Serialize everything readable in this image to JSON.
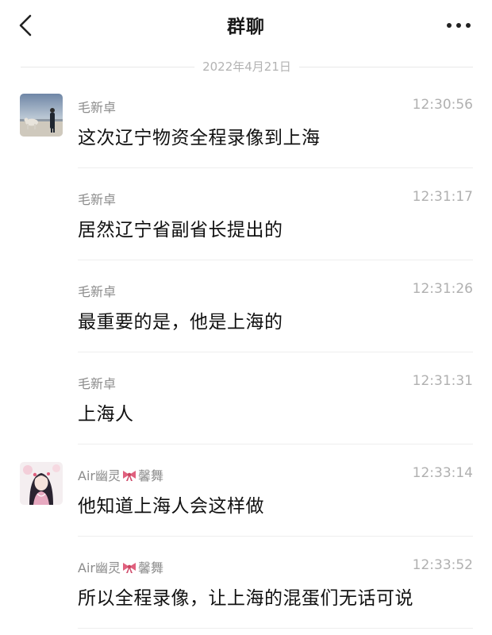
{
  "header": {
    "title": "群聊",
    "back_icon": "chevron-left-icon",
    "more_icon": "more-dots-icon"
  },
  "date_divider": "2022年4月21日",
  "colors": {
    "text_primary": "#111111",
    "text_secondary": "#8c8c8c",
    "time": "#b0b0b0",
    "divider": "#eeeeee",
    "bow_pink": "#e0607e"
  },
  "messages": [
    {
      "sender": "毛新卓",
      "time": "12:30:56",
      "text": "这次辽宁物资全程录像到上海",
      "avatar": "beach-photo-avatar"
    },
    {
      "sender": "毛新卓",
      "time": "12:31:17",
      "text": "居然辽宁省副省长提出的"
    },
    {
      "sender": "毛新卓",
      "time": "12:31:26",
      "text": "最重要的是，他是上海的"
    },
    {
      "sender": "毛新卓",
      "time": "12:31:31",
      "text": "上海人"
    },
    {
      "sender_prefix": "Air幽灵",
      "sender_emoji": "ribbon-bow-emoji",
      "sender_suffix": "馨舞",
      "time": "12:33:14",
      "text": "他知道上海人会这样做",
      "avatar": "anime-girl-avatar"
    },
    {
      "sender_prefix": "Air幽灵",
      "sender_emoji": "ribbon-bow-emoji",
      "sender_suffix": "馨舞",
      "time": "12:33:52",
      "text": "所以全程录像，让上海的混蛋们无话可说"
    }
  ]
}
